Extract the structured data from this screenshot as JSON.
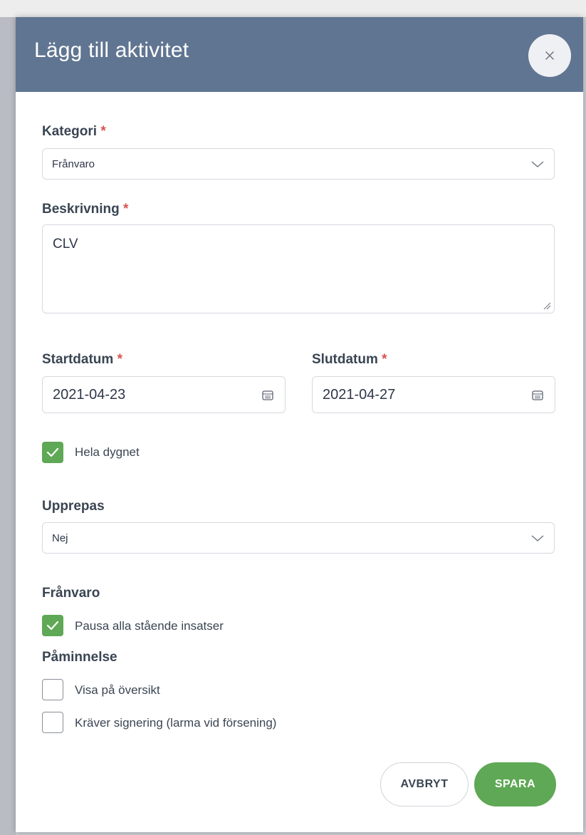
{
  "modal": {
    "title": "Lägg till aktivitet"
  },
  "form": {
    "required_marker": "*",
    "kategori": {
      "label": "Kategori",
      "value": "Frånvaro"
    },
    "beskrivning": {
      "label": "Beskrivning",
      "value": "CLV"
    },
    "startdatum": {
      "label": "Startdatum",
      "value": "2021-04-23"
    },
    "slutdatum": {
      "label": "Slutdatum",
      "value": "2021-04-27"
    },
    "hela_dygnet": {
      "label": "Hela dygnet",
      "checked": true
    },
    "upprepas": {
      "label": "Upprepas",
      "value": "Nej"
    },
    "franvaro_section": {
      "label": "Frånvaro",
      "pausa": {
        "label": "Pausa alla stående insatser",
        "checked": true
      }
    },
    "paminnelse_section": {
      "label": "Påminnelse",
      "visa": {
        "label": "Visa på översikt",
        "checked": false
      },
      "kraver": {
        "label": "Kräver signering (larma vid försening)",
        "checked": false
      }
    }
  },
  "buttons": {
    "cancel": "AVBRYT",
    "save": "SPARA"
  },
  "colors": {
    "header_bg": "#607591",
    "accent_green": "#5fa855",
    "required_red": "#d9534f"
  },
  "icons": {
    "close": "close-icon",
    "dropdown": "chevron-down-icon",
    "calendar": "calendar-icon",
    "check": "check-icon",
    "resize": "resize-handle-icon"
  }
}
